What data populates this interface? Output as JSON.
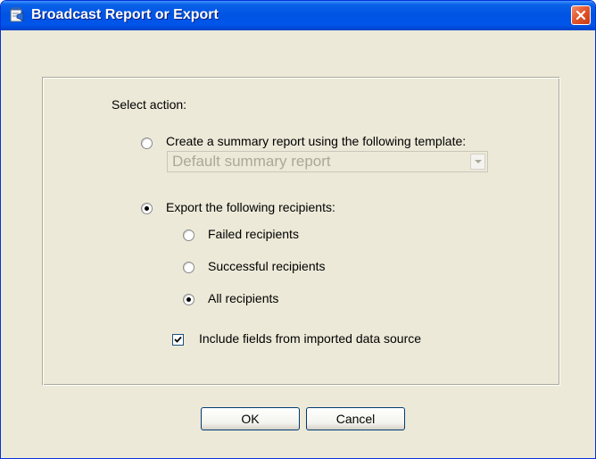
{
  "window": {
    "title": "Broadcast Report or Export"
  },
  "form": {
    "select_action_label": "Select action:",
    "summary_option": {
      "label": "Create a summary report using the following template:",
      "selected": false
    },
    "template_dropdown": {
      "value": "Default summary report",
      "enabled": false
    },
    "export_option": {
      "label": "Export the following recipients:",
      "selected": true
    },
    "recipient_options": [
      {
        "label": "Failed recipients",
        "selected": false
      },
      {
        "label": "Successful recipients",
        "selected": false
      },
      {
        "label": "All recipients",
        "selected": true
      }
    ],
    "include_fields": {
      "label": "Include fields from imported data source",
      "checked": true
    }
  },
  "buttons": {
    "ok_label": "OK",
    "cancel_label": "Cancel"
  }
}
